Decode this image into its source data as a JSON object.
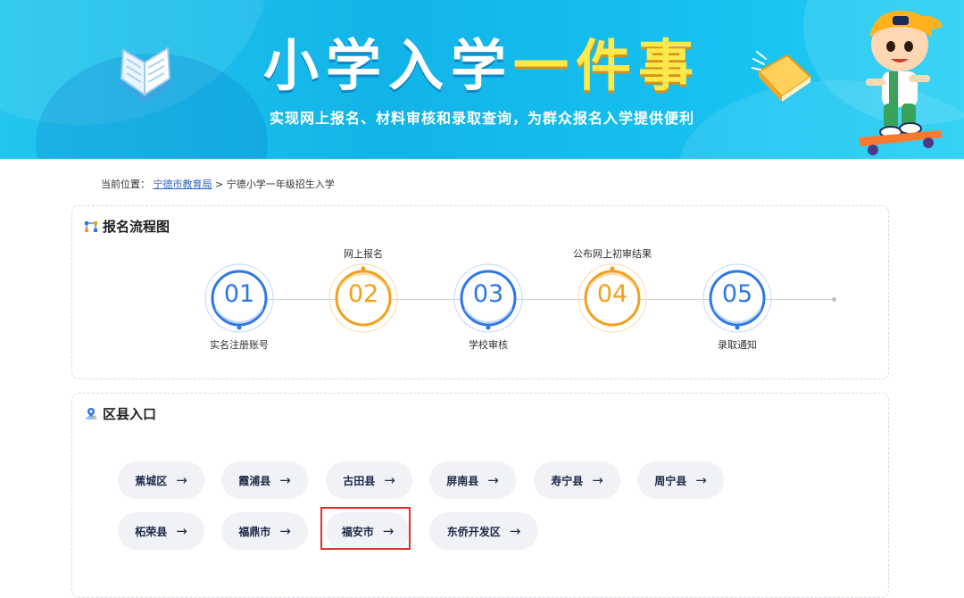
{
  "banner": {
    "title_part1": "小学入学",
    "title_part2": "一件事",
    "subtitle": "实现网上报名、材料审核和录取查询，为群众报名入学提供便利",
    "left_icon": "open-book-icon",
    "right_icon": "flying-book-icon",
    "mascot": "skateboard-kid-illustration"
  },
  "breadcrumb": {
    "prefix": "当前位置：",
    "link": "宁德市教育局",
    "separator": " > ",
    "current": "宁德小学一年级招生入学"
  },
  "process": {
    "title": "报名流程图",
    "icon": "flow-chart-icon",
    "steps": [
      {
        "num": "01",
        "label": "实名注册账号",
        "label_pos": "below",
        "color": "blue"
      },
      {
        "num": "02",
        "label": "网上报名",
        "label_pos": "above",
        "color": "orange"
      },
      {
        "num": "03",
        "label": "学校审核",
        "label_pos": "below",
        "color": "blue"
      },
      {
        "num": "04",
        "label": "公布网上初审结果",
        "label_pos": "above",
        "color": "orange"
      },
      {
        "num": "05",
        "label": "录取通知",
        "label_pos": "below",
        "color": "blue"
      }
    ]
  },
  "districts": {
    "title": "区县入口",
    "icon": "map-pin-icon",
    "arrow": "→",
    "items": [
      "蕉城区",
      "霞浦县",
      "古田县",
      "屏南县",
      "寿宁县",
      "周宁县",
      "柘荣县",
      "福鼎市",
      "福安市",
      "东侨开发区"
    ],
    "highlighted": "福安市"
  },
  "colors": {
    "banner_blue": "#12b4e8",
    "title_yellow": "#ffe84a",
    "step_blue": "#2d77e6",
    "step_orange": "#f2a01c",
    "highlight_red": "#e3302b",
    "pill_bg": "#f1f2f5"
  }
}
